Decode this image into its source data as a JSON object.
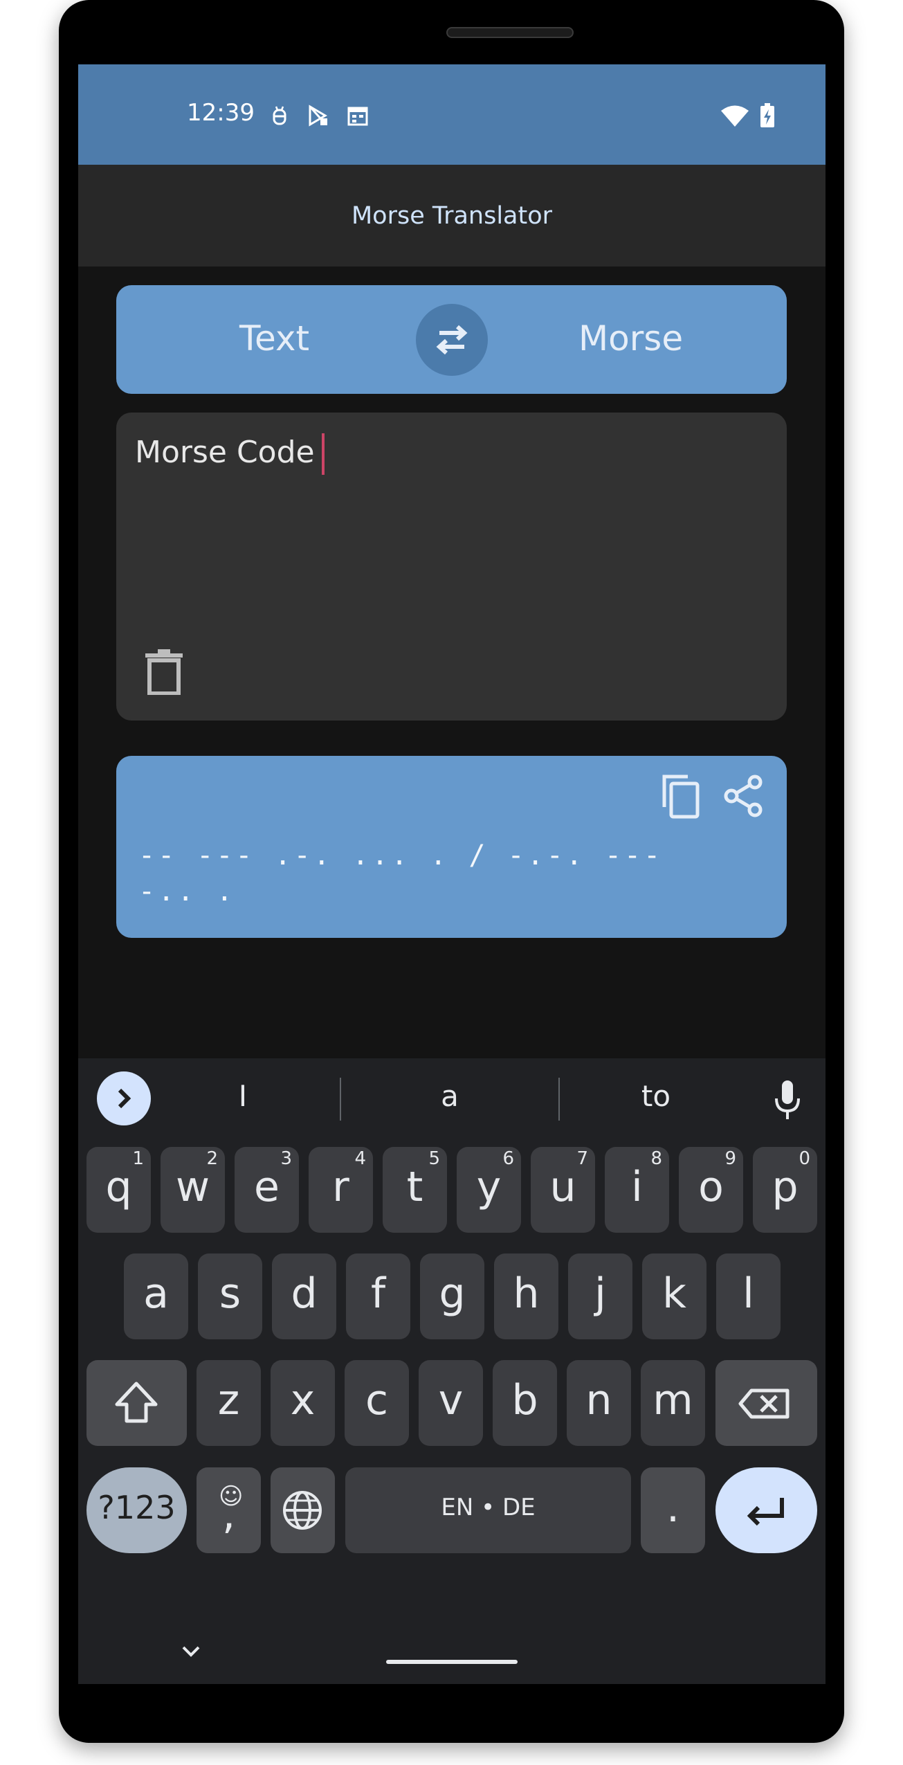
{
  "status_bar": {
    "time": "12:39"
  },
  "app_bar": {
    "title": "Morse Translator"
  },
  "toggle": {
    "left_label": "Text",
    "right_label": "Morse"
  },
  "input": {
    "value": "Morse Code"
  },
  "output": {
    "morse": "-- --- .-. ... . / -.-. ---\n-.. ."
  },
  "keyboard": {
    "suggestions": [
      "I",
      "a",
      "to"
    ],
    "row1": [
      {
        "label": "q",
        "num": "1"
      },
      {
        "label": "w",
        "num": "2"
      },
      {
        "label": "e",
        "num": "3"
      },
      {
        "label": "r",
        "num": "4"
      },
      {
        "label": "t",
        "num": "5"
      },
      {
        "label": "y",
        "num": "6"
      },
      {
        "label": "u",
        "num": "7"
      },
      {
        "label": "i",
        "num": "8"
      },
      {
        "label": "o",
        "num": "9"
      },
      {
        "label": "p",
        "num": "0"
      }
    ],
    "row2": [
      "a",
      "s",
      "d",
      "f",
      "g",
      "h",
      "j",
      "k",
      "l"
    ],
    "row3": [
      "z",
      "x",
      "c",
      "v",
      "b",
      "n",
      "m"
    ],
    "symbols_label": "?123",
    "emoji_label": ",",
    "space_label": "EN • DE",
    "period_label": "."
  },
  "colors": {
    "status_bar": "#4e7cab",
    "card_blue": "#6699cc",
    "swap_button": "#4b7bab",
    "input_card": "#323232",
    "caret": "#cc4466"
  },
  "icons": [
    "bug-icon",
    "play-store-icon",
    "calendar-icon",
    "wifi-icon",
    "battery-icon",
    "swap-icon",
    "delete-icon",
    "copy-icon",
    "share-icon",
    "mic-icon",
    "shift-icon",
    "backspace-icon",
    "globe-icon",
    "enter-icon"
  ]
}
